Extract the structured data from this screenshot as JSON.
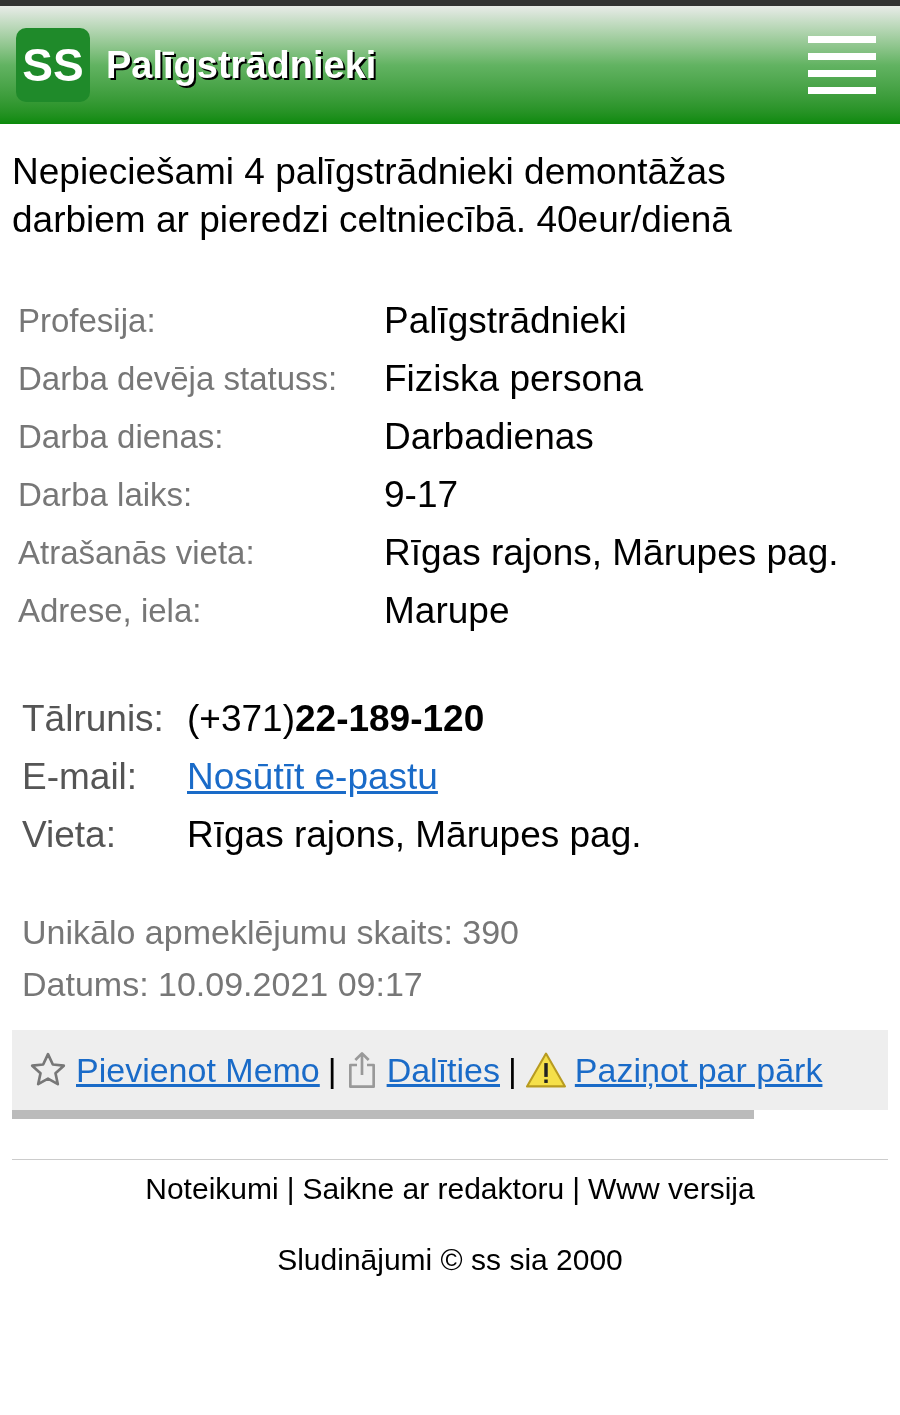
{
  "header": {
    "logo": "SS",
    "title": "Palīgstrādnieki"
  },
  "description": "Nepieciešami 4 palīgstrādnieki demontāžas darbiem ar pieredzi celtniecībā. 40eur/dienā",
  "details": [
    {
      "label": "Profesija:",
      "value": "Palīgstrādnieki"
    },
    {
      "label": "Darba devēja statuss:",
      "value": "Fiziska persona"
    },
    {
      "label": "Darba dienas:",
      "value": "Darbadienas"
    },
    {
      "label": "Darba laiks:",
      "value": "9-17"
    },
    {
      "label": "Atrašanās vieta:",
      "value": "Rīgas rajons, Mārupes pag."
    },
    {
      "label": "Adrese, iela:",
      "value": "Marupe"
    }
  ],
  "contacts": [
    {
      "kind": "phone",
      "label": "Tālrunis:",
      "value": "(+371)**22-189-120**"
    },
    {
      "kind": "link",
      "label": "E-mail:",
      "value": "Nosūtīt e-pastu"
    },
    {
      "kind": "text",
      "label": "Vieta:",
      "value": "Rīgas rajons, Mārupes pag."
    }
  ],
  "stats": [
    "Unikālo apmeklējumu skaits: 390",
    "Datums: 10.09.2021 09:17"
  ],
  "action_separator": "|",
  "actions": [
    {
      "kind": "star",
      "label": "Pievienot Memo"
    },
    {
      "kind": "share",
      "label": "Dalīties"
    },
    {
      "kind": "warning",
      "label": "Paziņot par pārk"
    }
  ],
  "footer": {
    "separator": "|",
    "links": [
      "Noteikumi",
      "Saikne ar redaktoru",
      "Www versija"
    ],
    "copyright": "Sludinājumi © ss sia 2000"
  }
}
